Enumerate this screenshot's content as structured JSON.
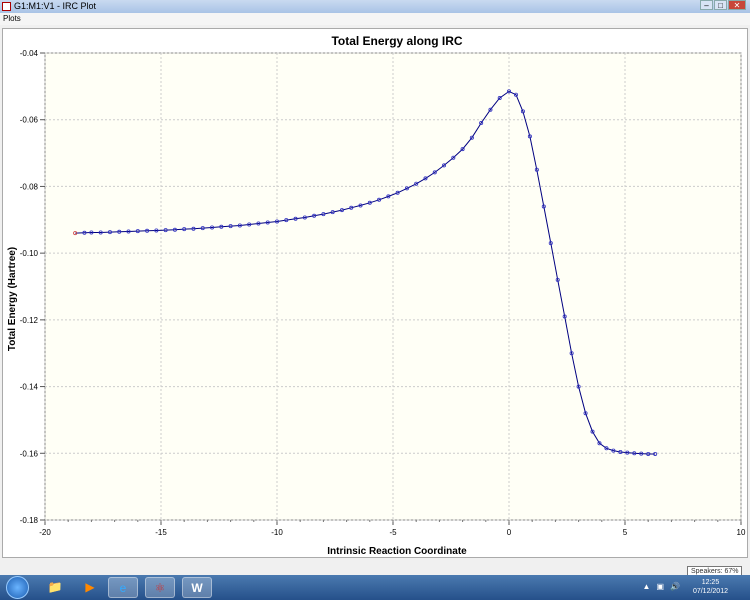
{
  "window": {
    "title": "G1:M1:V1 - IRC Plot",
    "menu": [
      "Plots"
    ]
  },
  "taskbar": {
    "time": "12:25",
    "date": "07/12/2012",
    "tooltip": "Speakers: 67%",
    "apps": [
      "windows-explorer",
      "media-player",
      "internet-explorer",
      "gaussview",
      "word"
    ]
  },
  "chart_data": {
    "type": "line",
    "title": "Total Energy along IRC",
    "xlabel": "Intrinsic Reaction Coordinate",
    "ylabel": "Total Energy (Hartree)",
    "xlim": [
      -20,
      10
    ],
    "ylim": [
      -0.18,
      -0.04
    ],
    "xticks": [
      -20,
      -15,
      -10,
      -5,
      0,
      5,
      10
    ],
    "yticks": [
      -0.18,
      -0.16,
      -0.14,
      -0.12,
      -0.1,
      -0.08,
      -0.06,
      -0.04
    ],
    "ytick_labels": [
      "-0.18",
      "-0.16",
      "-0.14",
      "-0.12",
      "-0.10",
      "-0.08",
      "-0.06",
      "-0.04"
    ],
    "grid": true,
    "series": [
      {
        "name": "Total Energy",
        "color": "#000080",
        "marker_color": "#3030c0",
        "x": [
          -18.7,
          -18.3,
          -18,
          -17.6,
          -17.2,
          -16.8,
          -16.4,
          -16,
          -15.6,
          -15.2,
          -14.8,
          -14.4,
          -14,
          -13.6,
          -13.2,
          -12.8,
          -12.4,
          -12,
          -11.6,
          -11.2,
          -10.8,
          -10.4,
          -10,
          -9.6,
          -9.2,
          -8.8,
          -8.4,
          -8,
          -7.6,
          -7.2,
          -6.8,
          -6.4,
          -6,
          -5.6,
          -5.2,
          -4.8,
          -4.4,
          -4,
          -3.6,
          -3.2,
          -2.8,
          -2.4,
          -2,
          -1.6,
          -1.2,
          -0.8,
          -0.4,
          0,
          0.3,
          0.6,
          0.9,
          1.2,
          1.5,
          1.8,
          2.1,
          2.4,
          2.7,
          3,
          3.3,
          3.6,
          3.9,
          4.2,
          4.5,
          4.8,
          5.1,
          5.4,
          5.7,
          6,
          6.3
        ],
        "y": [
          -0.094,
          -0.0939,
          -0.0938,
          -0.0938,
          -0.0937,
          -0.0936,
          -0.0935,
          -0.0934,
          -0.0933,
          -0.0932,
          -0.0931,
          -0.093,
          -0.0928,
          -0.0927,
          -0.0925,
          -0.0923,
          -0.0921,
          -0.0919,
          -0.0917,
          -0.0914,
          -0.0911,
          -0.0908,
          -0.0905,
          -0.0901,
          -0.0897,
          -0.0893,
          -0.0888,
          -0.0883,
          -0.0877,
          -0.0871,
          -0.0864,
          -0.0857,
          -0.0849,
          -0.084,
          -0.083,
          -0.0819,
          -0.0806,
          -0.0792,
          -0.0776,
          -0.0758,
          -0.0737,
          -0.0714,
          -0.0688,
          -0.0654,
          -0.061,
          -0.057,
          -0.0535,
          -0.0515,
          -0.0525,
          -0.0575,
          -0.065,
          -0.075,
          -0.086,
          -0.097,
          -0.108,
          -0.119,
          -0.13,
          -0.14,
          -0.148,
          -0.1535,
          -0.157,
          -0.1585,
          -0.1592,
          -0.1596,
          -0.1598,
          -0.16,
          -0.1601,
          -0.1602,
          -0.1602
        ]
      }
    ]
  }
}
